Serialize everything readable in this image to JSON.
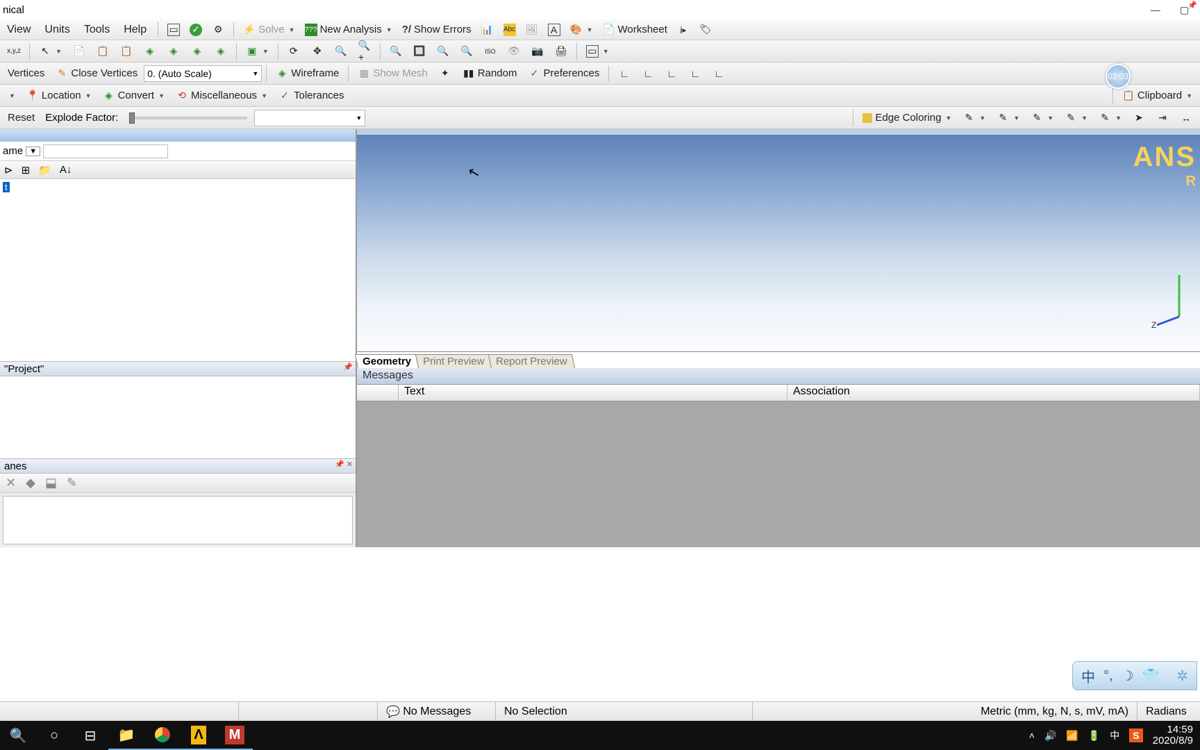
{
  "title_fragment": "nical",
  "menus": [
    "View",
    "Units",
    "Tools",
    "Help"
  ],
  "tb1": {
    "solve": "Solve",
    "new_analysis": "New Analysis",
    "show_errors": "Show Errors",
    "worksheet": "Worksheet"
  },
  "tb3": {
    "vertices": "Vertices",
    "close_vertices": "Close Vertices",
    "scale": "0. (Auto Scale)",
    "wireframe": "Wireframe",
    "show_mesh": "Show Mesh",
    "random": "Random",
    "preferences": "Preferences"
  },
  "tb4": {
    "location": "Location",
    "convert": "Convert",
    "misc": "Miscellaneous",
    "tolerances": "Tolerances",
    "clipboard": "Clipboard"
  },
  "tb5": {
    "reset": "Reset",
    "explode": "Explode Factor:",
    "edge": "Edge Coloring"
  },
  "outline": {
    "filter_label": "ame",
    "root": "t"
  },
  "details_title": "\"Project\"",
  "panes_title": "anes",
  "viewport": {
    "brand": "ANS",
    "brand2": "R",
    "tabs": [
      "Geometry",
      "Print Preview",
      "Report Preview"
    ]
  },
  "messages": {
    "title": "Messages",
    "cols": [
      "",
      "Text",
      "Association"
    ]
  },
  "status": {
    "msgs": "No Messages",
    "sel": "No Selection",
    "units": "Metric (mm, kg, N, s, mV, mA)",
    "ang": "Radians"
  },
  "timer": "02:03",
  "tray": {
    "ime1": "中",
    "ime_s": "S",
    "time": "14:59",
    "date": "2020/8/9"
  },
  "ime_panel": "中"
}
